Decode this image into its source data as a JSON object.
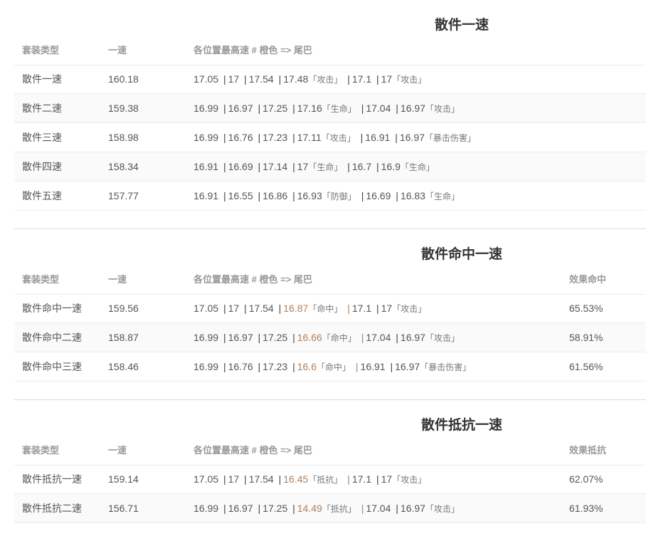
{
  "sections": [
    {
      "title": "散件一速",
      "headers": [
        "套装类型",
        "一速",
        "各位置最高速 # 橙色 => 尾巴",
        ""
      ],
      "rows": [
        {
          "type": "散件一速",
          "speed": "160.18",
          "parts": [
            {
              "v": "17.05"
            },
            {
              "v": "17"
            },
            {
              "v": "17.54"
            },
            {
              "v": "17.48",
              "tag": "「攻击」"
            },
            {
              "v": "17.1"
            },
            {
              "v": "17",
              "tag": "「攻击」"
            }
          ],
          "extra": ""
        },
        {
          "type": "散件二速",
          "speed": "159.38",
          "parts": [
            {
              "v": "16.99"
            },
            {
              "v": "16.97"
            },
            {
              "v": "17.25"
            },
            {
              "v": "17.16",
              "tag": "「生命」"
            },
            {
              "v": "17.04"
            },
            {
              "v": "16.97",
              "tag": "「攻击」"
            }
          ],
          "extra": ""
        },
        {
          "type": "散件三速",
          "speed": "158.98",
          "parts": [
            {
              "v": "16.99"
            },
            {
              "v": "16.76"
            },
            {
              "v": "17.23"
            },
            {
              "v": "17.11",
              "tag": "「攻击」"
            },
            {
              "v": "16.91"
            },
            {
              "v": "16.97",
              "tag": "「暴击伤害」"
            }
          ],
          "extra": ""
        },
        {
          "type": "散件四速",
          "speed": "158.34",
          "parts": [
            {
              "v": "16.91"
            },
            {
              "v": "16.69"
            },
            {
              "v": "17.14"
            },
            {
              "v": "17",
              "tag": "「生命」"
            },
            {
              "v": "16.7"
            },
            {
              "v": "16.9",
              "tag": "「生命」"
            }
          ],
          "extra": ""
        },
        {
          "type": "散件五速",
          "speed": "157.77",
          "parts": [
            {
              "v": "16.91"
            },
            {
              "v": "16.55"
            },
            {
              "v": "16.86"
            },
            {
              "v": "16.93",
              "tag": "「防御」"
            },
            {
              "v": "16.69"
            },
            {
              "v": "16.83",
              "tag": "「生命」"
            }
          ],
          "extra": ""
        }
      ]
    },
    {
      "title": "散件命中一速",
      "headers": [
        "套装类型",
        "一速",
        "各位置最高速 # 橙色 => 尾巴",
        "效果命中"
      ],
      "rows": [
        {
          "type": "散件命中一速",
          "speed": "159.56",
          "parts": [
            {
              "v": "17.05"
            },
            {
              "v": "17"
            },
            {
              "v": "17.54"
            },
            {
              "v": "16.87",
              "tag": "「命中」",
              "hl": true
            },
            {
              "v": "17.1"
            },
            {
              "v": "17",
              "tag": "「攻击」"
            }
          ],
          "extra": "65.53%"
        },
        {
          "type": "散件命中二速",
          "speed": "158.87",
          "parts": [
            {
              "v": "16.99"
            },
            {
              "v": "16.97"
            },
            {
              "v": "17.25"
            },
            {
              "v": "16.66",
              "tag": "「命中」",
              "hl": true
            },
            {
              "v": "17.04"
            },
            {
              "v": "16.97",
              "tag": "「攻击」"
            }
          ],
          "extra": "58.91%"
        },
        {
          "type": "散件命中三速",
          "speed": "158.46",
          "parts": [
            {
              "v": "16.99"
            },
            {
              "v": "16.76"
            },
            {
              "v": "17.23"
            },
            {
              "v": "16.6",
              "tag": "「命中」",
              "hl": true
            },
            {
              "v": "16.91"
            },
            {
              "v": "16.97",
              "tag": "「暴击伤害」"
            }
          ],
          "extra": "61.56%"
        }
      ]
    },
    {
      "title": "散件抵抗一速",
      "headers": [
        "套装类型",
        "一速",
        "各位置最高速 # 橙色 => 尾巴",
        "效果抵抗"
      ],
      "rows": [
        {
          "type": "散件抵抗一速",
          "speed": "159.14",
          "parts": [
            {
              "v": "17.05"
            },
            {
              "v": "17"
            },
            {
              "v": "17.54"
            },
            {
              "v": "16.45",
              "tag": "「抵抗」",
              "hl": true
            },
            {
              "v": "17.1"
            },
            {
              "v": "17",
              "tag": "「攻击」"
            }
          ],
          "extra": "62.07%"
        },
        {
          "type": "散件抵抗二速",
          "speed": "156.71",
          "parts": [
            {
              "v": "16.99"
            },
            {
              "v": "16.97"
            },
            {
              "v": "17.25"
            },
            {
              "v": "14.49",
              "tag": "「抵抗」",
              "hl": true
            },
            {
              "v": "17.04"
            },
            {
              "v": "16.97",
              "tag": "「攻击」"
            }
          ],
          "extra": "61.93%"
        }
      ]
    }
  ],
  "colors": {
    "highlight": "#b0805c",
    "tag": "#777777",
    "divider": "#dcdcdc"
  }
}
